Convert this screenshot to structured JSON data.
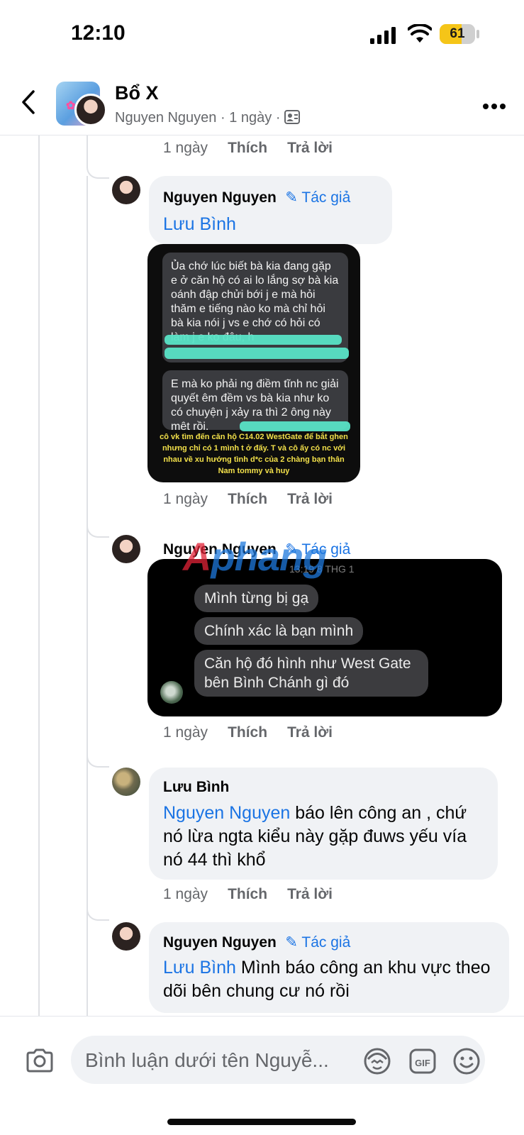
{
  "status": {
    "time": "12:10",
    "battery": "61",
    "battery_level": 0.61
  },
  "header": {
    "title": "Bổ X",
    "author": "Nguyen Nguyen",
    "sep1": "·",
    "age": "1 ngày",
    "sep2": "·"
  },
  "actions": {
    "age": "1 ngày",
    "like": "Thích",
    "reply": "Trả lời"
  },
  "comments": [
    {
      "name": "Nguyen Nguyen",
      "badge": "Tác giả",
      "mention": "Lưu Bình",
      "text": "",
      "attachment": {
        "msg1": "Ủa chớ lúc biết bà kia đang gặp e ở căn hộ có ai lo lắng sợ bà kia oánh đập chửi bới j e mà hỏi thăm e tiếng nào ko mà chỉ hỏi bà kia nói j vs e chớ có hỏi có làm j e ko đâu, h",
        "msg2": "E mà ko phải ng điềm tĩnh nc giải quyết êm đềm vs bà kia như ko có chuyện j xảy ra thì 2 ông này mệt rồi,",
        "caption": "cô vk tìm đến căn hộ C14.02 WestGate để bắt ghen nhưng chỉ có 1 mình t ở đấy. T và cô ấy có nc với nhau về xu hướng tình d*c của 2 chàng bạn thân Nam tommy và huy"
      }
    },
    {
      "name": "Nguyen Nguyen",
      "badge": "Tác giả",
      "attachment": {
        "timestamp": "13:19 8 THG 1",
        "messages": [
          "Mình từng bị gạ",
          "Chính xác là bạn mình",
          "Căn hộ đó hình như West Gate bên Bình Chánh gì đó"
        ]
      }
    },
    {
      "name": "Lưu Bình",
      "mention": "Nguyen Nguyen",
      "text": " báo lên công an , chứ nó lừa ngta kiểu này gặp đuws yếu vía nó 44 thì khổ"
    },
    {
      "name": "Nguyen Nguyen",
      "badge": "Tác giả",
      "mention": "Lưu Bình",
      "text": " Mình báo công an khu vực theo dõi bên chung cư nó rồi"
    }
  ],
  "watermark": {
    "part1": "A",
    "part2": "phang"
  },
  "composer": {
    "placeholder": "Bình luận dưới tên Nguyễ..."
  },
  "colors": {
    "link": "#1b74e4",
    "bubble": "#f0f2f5",
    "meta": "#65676b",
    "highlight": "#59e3c6"
  }
}
